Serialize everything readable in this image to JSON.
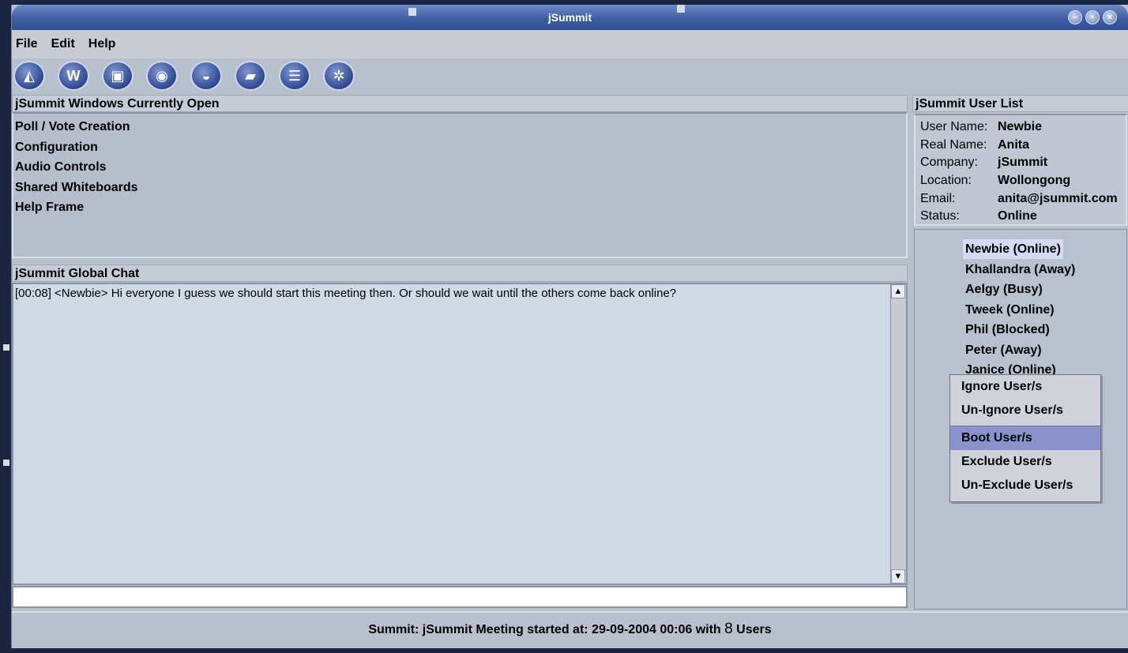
{
  "window": {
    "title": "jSummit"
  },
  "menubar": {
    "items": [
      "File",
      "Edit",
      "Help"
    ]
  },
  "toolbar": {
    "buttons": [
      {
        "icon": "poll-icon",
        "glyph": "◭"
      },
      {
        "icon": "whiteboard-icon",
        "glyph": "W"
      },
      {
        "icon": "documents-icon",
        "glyph": "▣"
      },
      {
        "icon": "audio-icon",
        "glyph": "◉"
      },
      {
        "icon": "chat-icon",
        "glyph": "◒"
      },
      {
        "icon": "folder-icon",
        "glyph": "▰"
      },
      {
        "icon": "list-icon",
        "glyph": "☰"
      },
      {
        "icon": "settings-icon",
        "glyph": "✲"
      }
    ]
  },
  "open_windows": {
    "title": "jSummit Windows Currently Open",
    "items": [
      "Poll / Vote Creation",
      "Configuration",
      "Audio Controls",
      "Shared Whiteboards",
      "Help Frame"
    ]
  },
  "chat": {
    "title": "jSummit Global Chat",
    "messages": [
      "[00:08] <Newbie> Hi everyone I guess we should start this meeting then. Or should we wait until the others come back online?"
    ],
    "input_value": ""
  },
  "user_panel": {
    "title": "jSummit User List",
    "info": [
      {
        "key": "User Name:",
        "value": "Newbie"
      },
      {
        "key": "Real Name:",
        "value": "Anita"
      },
      {
        "key": "Company:",
        "value": "jSummit"
      },
      {
        "key": "Location:",
        "value": "Wollongong"
      },
      {
        "key": "Email:",
        "value": "anita@jsummit.com"
      },
      {
        "key": "Status:",
        "value": "Online"
      }
    ],
    "users": [
      "Newbie (Online)",
      "Khallandra (Away)",
      "Aelgy (Busy)",
      "Tweek (Online)",
      "Phil (Blocked)",
      "Peter (Away)",
      "Janice (Online)"
    ]
  },
  "context_menu": {
    "items": [
      "Ignore User/s",
      "Un-Ignore User/s",
      "Boot User/s",
      "Exclude User/s",
      "Un-Exclude User/s"
    ]
  },
  "status_bar": {
    "prefix": "Summit: jSummit Meeting  started at: 29-09-2004 00:06  with ",
    "user_count": "8",
    "suffix": " Users"
  },
  "colors": {
    "title_bar": "#3e5ea3",
    "selected_menu_item": "#8893cc",
    "selected_user": "#d5d9f2"
  }
}
